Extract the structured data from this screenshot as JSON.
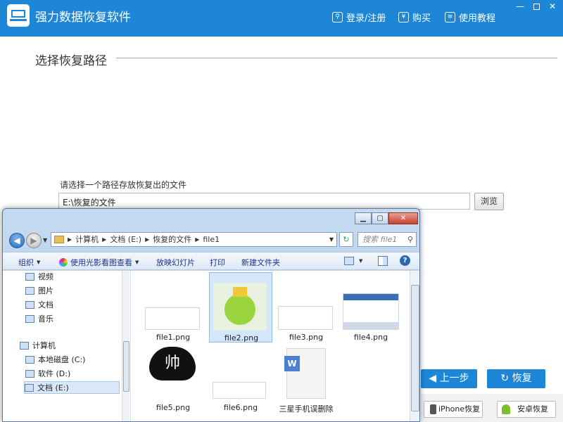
{
  "app": {
    "title": "强力数据恢复软件",
    "nav": {
      "login": "登录/注册",
      "buy": "购买",
      "tutorial": "使用教程"
    },
    "window_controls": {
      "minimize": "—",
      "restore": "▢",
      "close": "✕"
    }
  },
  "main": {
    "section_title": "选择恢复路径",
    "path_label": "请选择一个路径存放恢复出的文件",
    "path_value": "E:\\恢复的文件",
    "browse_label": "浏览"
  },
  "footer": {
    "prev_label": "上一步",
    "recover_label": "恢复",
    "iphone_label": "iPhone恢复",
    "android_label": "安卓恢复"
  },
  "explorer": {
    "breadcrumbs": [
      "计算机",
      "文档 (E:)",
      "恢复的文件",
      "file1"
    ],
    "search_placeholder": "搜索 file1",
    "toolbar": {
      "organize": "组织",
      "view_with": "使用光影看图查看",
      "slideshow": "放映幻灯片",
      "print": "打印",
      "new_folder": "新建文件夹"
    },
    "nav_items": [
      "视频",
      "图片",
      "文档",
      "音乐",
      "计算机",
      "本地磁盘 (C:)",
      "软件 (D:)",
      "文档 (E:)"
    ],
    "files": [
      {
        "name": "file1.png"
      },
      {
        "name": "file2.png"
      },
      {
        "name": "file3.png"
      },
      {
        "name": "file4.png"
      },
      {
        "name": "file5.png",
        "thumb_text": "帅"
      },
      {
        "name": "file6.png"
      },
      {
        "name": "三星手机误删除"
      }
    ],
    "colors": {
      "accent": "#1d86d6",
      "selection": "#d4e6fb"
    }
  }
}
